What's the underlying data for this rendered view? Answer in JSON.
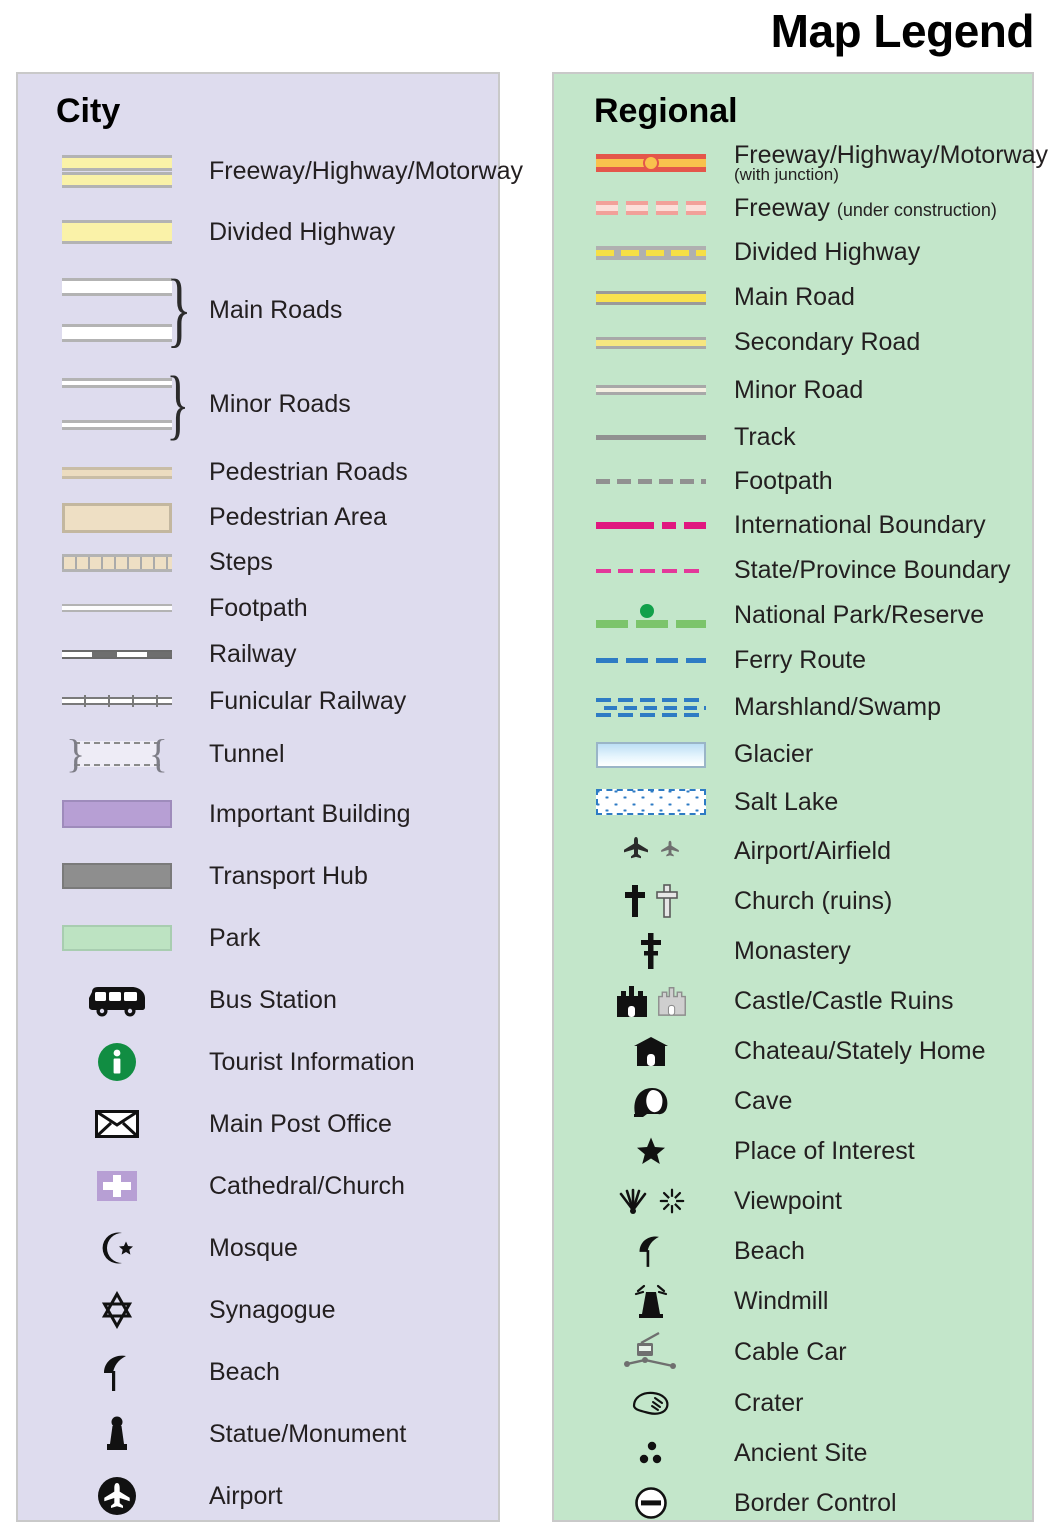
{
  "title": "Map Legend",
  "city": {
    "heading": "City",
    "background": "#dedcee",
    "items": [
      {
        "label": "Freeway/Highway/Motorway",
        "symbol": "freeway-double-band"
      },
      {
        "label": "Divided Highway",
        "symbol": "divided-highway-band"
      },
      {
        "label": "Main Roads",
        "symbol": "main-roads-brace"
      },
      {
        "label": "Minor Roads",
        "symbol": "minor-roads-brace"
      },
      {
        "label": "Pedestrian Roads",
        "symbol": "pedestrian-road-band"
      },
      {
        "label": "Pedestrian Area",
        "symbol": "pedestrian-area-box"
      },
      {
        "label": "Steps",
        "symbol": "steps-hatched-band"
      },
      {
        "label": "Footpath",
        "symbol": "footpath-thin-line"
      },
      {
        "label": "Railway",
        "symbol": "railway-dashed-line"
      },
      {
        "label": "Funicular Railway",
        "symbol": "funicular-ticked-line"
      },
      {
        "label": "Tunnel",
        "symbol": "tunnel-braces-dashed"
      },
      {
        "label": "Important Building",
        "symbol": "important-building-swatch"
      },
      {
        "label": "Transport Hub",
        "symbol": "transport-hub-swatch"
      },
      {
        "label": "Park",
        "symbol": "park-swatch"
      },
      {
        "label": "Bus Station",
        "symbol": "bus-icon"
      },
      {
        "label": "Tourist Information",
        "symbol": "info-circle-icon"
      },
      {
        "label": "Main Post Office",
        "symbol": "envelope-icon"
      },
      {
        "label": "Cathedral/Church",
        "symbol": "cross-on-purple-icon"
      },
      {
        "label": "Mosque",
        "symbol": "crescent-star-icon"
      },
      {
        "label": "Synagogue",
        "symbol": "star-of-david-icon"
      },
      {
        "label": "Beach",
        "symbol": "parasol-icon"
      },
      {
        "label": "Statue/Monument",
        "symbol": "statue-icon"
      },
      {
        "label": "Airport",
        "symbol": "airplane-circle-icon"
      }
    ]
  },
  "regional": {
    "heading": "Regional",
    "background": "#c3e6ca",
    "items": [
      {
        "label": "Freeway/Highway/Motorway",
        "sub": "(with junction)",
        "symbol": "freeway-junction-line"
      },
      {
        "label": "Freeway",
        "sub_inline": "(under construction)",
        "symbol": "freeway-under-construction-line"
      },
      {
        "label": "Divided Highway",
        "symbol": "divided-highway-line"
      },
      {
        "label": "Main Road",
        "symbol": "main-road-line"
      },
      {
        "label": "Secondary Road",
        "symbol": "secondary-road-line"
      },
      {
        "label": "Minor Road",
        "symbol": "minor-road-line"
      },
      {
        "label": "Track",
        "symbol": "track-line"
      },
      {
        "label": "Footpath",
        "symbol": "footpath-dashed-line"
      },
      {
        "label": "International Boundary",
        "symbol": "international-boundary-line"
      },
      {
        "label": "State/Province Boundary",
        "symbol": "state-boundary-line"
      },
      {
        "label": "National Park/Reserve",
        "symbol": "national-park-line"
      },
      {
        "label": "Ferry Route",
        "symbol": "ferry-route-line"
      },
      {
        "label": "Marshland/Swamp",
        "symbol": "marshland-pattern"
      },
      {
        "label": "Glacier",
        "symbol": "glacier-swatch"
      },
      {
        "label": "Salt Lake",
        "symbol": "salt-lake-swatch"
      },
      {
        "label": "Airport/Airfield",
        "symbol": "airplane-pair-icon"
      },
      {
        "label": "Church (ruins)",
        "symbol": "church-cross-pair-icon"
      },
      {
        "label": "Monastery",
        "symbol": "monastery-cross-icon"
      },
      {
        "label": "Castle/Castle Ruins",
        "symbol": "castle-pair-icon"
      },
      {
        "label": "Chateau/Stately Home",
        "symbol": "chateau-icon"
      },
      {
        "label": "Cave",
        "symbol": "cave-icon"
      },
      {
        "label": "Place of Interest",
        "symbol": "star-icon"
      },
      {
        "label": "Viewpoint",
        "symbol": "viewpoint-pair-icon"
      },
      {
        "label": "Beach",
        "symbol": "parasol-icon"
      },
      {
        "label": "Windmill",
        "symbol": "windmill-icon"
      },
      {
        "label": "Cable Car",
        "symbol": "cable-car-icon"
      },
      {
        "label": "Crater",
        "symbol": "crater-icon"
      },
      {
        "label": "Ancient Site",
        "symbol": "ancient-site-dots-icon"
      },
      {
        "label": "Border Control",
        "symbol": "border-control-icon"
      }
    ]
  },
  "colors": {
    "city_panel": "#dedcee",
    "regional_panel": "#c3e6ca",
    "panel_border": "#c9c9c9",
    "highway_yellow": "#faf2a8",
    "freeway_red": "#e4564b",
    "freeway_orange": "#f9c24d",
    "pedestrian_tan": "#eedfc4",
    "important_building_purple": "#b79fd4",
    "transport_hub_grey": "#8e8e8e",
    "park_green": "#bde3c2",
    "info_green": "#118d42",
    "boundary_magenta": "#e0187f",
    "ferry_blue": "#2e7bc4",
    "park_line_green": "#7cc46b",
    "text": "#231f20"
  }
}
